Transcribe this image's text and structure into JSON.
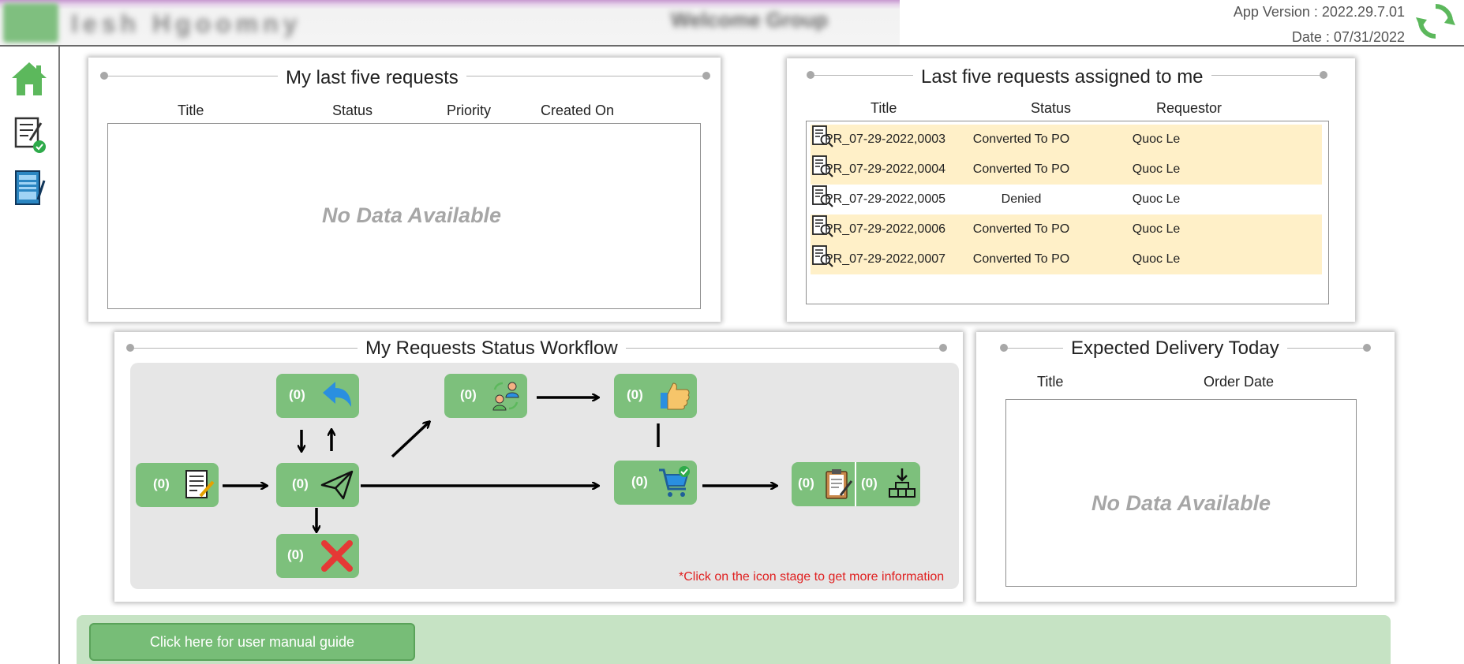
{
  "header": {
    "blurred_app_title": "Iesh Hgoomny",
    "blurred_welcome": "Welcome Group",
    "app_version": "App Version : 2022.29.7.01",
    "date": "Date : 07/31/2022",
    "refresh_icon": "refresh-icon"
  },
  "sidebar": {
    "items": [
      {
        "icon": "home-icon"
      },
      {
        "icon": "approve-document-icon"
      },
      {
        "icon": "request-list-icon"
      }
    ]
  },
  "my_requests": {
    "title": "My last five requests",
    "columns": [
      "Title",
      "Status",
      "Priority",
      "Created On"
    ],
    "empty_text": "No Data Available"
  },
  "assigned": {
    "title": "Last five requests assigned to me",
    "columns": [
      "Title",
      "Status",
      "Requestor"
    ],
    "rows": [
      {
        "title": "PR_07-29-2022,0003",
        "status": "Converted To PO",
        "requestor": "Quoc Le",
        "highlight": true
      },
      {
        "title": "PR_07-29-2022,0004",
        "status": "Converted To PO",
        "requestor": "Quoc Le",
        "highlight": true
      },
      {
        "title": "PR_07-29-2022,0005",
        "status": "Denied",
        "requestor": "Quoc Le",
        "highlight": false
      },
      {
        "title": "PR_07-29-2022,0006",
        "status": "Converted To PO",
        "requestor": "Quoc Le",
        "highlight": true
      },
      {
        "title": "PR_07-29-2022,0007",
        "status": "Converted To PO",
        "requestor": "Quoc Le",
        "highlight": true
      }
    ],
    "row_icon": "document-search-icon"
  },
  "workflow": {
    "title": "My Requests Status Workflow",
    "hint": "*Click on the icon stage to get more information",
    "stages": {
      "draft": {
        "count": "(0)",
        "icon": "draft-document-icon"
      },
      "returned": {
        "count": "(0)",
        "icon": "return-arrow-icon"
      },
      "submitted": {
        "count": "(0)",
        "icon": "paper-plane-icon"
      },
      "denied": {
        "count": "(0)",
        "icon": "red-x-icon"
      },
      "reassigned": {
        "count": "(0)",
        "icon": "people-exchange-icon"
      },
      "approved": {
        "count": "(0)",
        "icon": "thumbs-up-icon"
      },
      "purchased": {
        "count": "(0)",
        "icon": "shopping-cart-icon"
      },
      "checked": {
        "count": "(0)",
        "icon": "clipboard-icon"
      },
      "received": {
        "count": "(0)",
        "icon": "receive-boxes-icon"
      }
    }
  },
  "delivery": {
    "title": "Expected Delivery Today",
    "columns": [
      "Title",
      "Order Date"
    ],
    "empty_text": "No Data Available"
  },
  "footer": {
    "manual_button": "Click here for user manual guide"
  },
  "colors": {
    "accent_green": "#7dc07c",
    "highlight_row": "#fff0c8",
    "hint_red": "#e02020"
  }
}
